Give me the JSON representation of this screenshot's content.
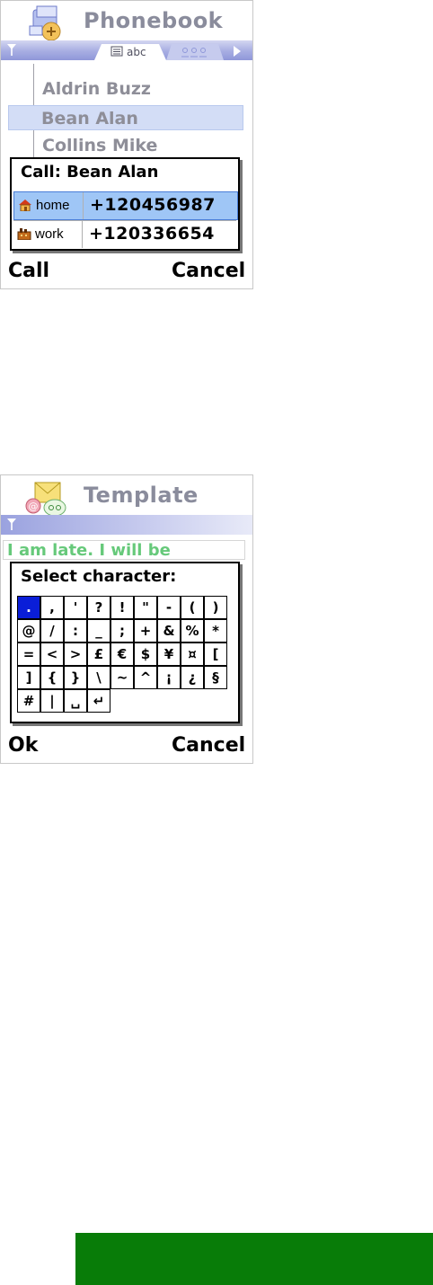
{
  "phonebook_screen": {
    "app_title": "Phonebook",
    "active_tab_label": "abc",
    "contacts": [
      "Aldrin Buzz",
      "Bean Alan",
      "Collins Mike"
    ],
    "selected_contact_index": 1,
    "dialog": {
      "title": "Call: Bean Alan",
      "numbers": [
        {
          "type_icon": "home-icon",
          "type": "home",
          "value": "+120456987",
          "selected": true
        },
        {
          "type_icon": "work-icon",
          "type": "work",
          "value": "+120336654",
          "selected": false
        }
      ]
    },
    "left_softkey": "Call",
    "right_softkey": "Cancel"
  },
  "template_screen": {
    "app_title": "Template",
    "editor_text": "I am late. I will be",
    "dialog": {
      "title": "Select character:",
      "characters": [
        [
          ".",
          ",",
          "'",
          "?",
          "!",
          "\"",
          "-",
          "(",
          ")"
        ],
        [
          "@",
          "/",
          ":",
          "_",
          ";",
          "+",
          "&",
          "%",
          "*"
        ],
        [
          "=",
          "<",
          ">",
          "£",
          "€",
          "$",
          "¥",
          "¤",
          "["
        ],
        [
          "]",
          "{",
          "}",
          "\\",
          "~",
          "^",
          "¡",
          "¿",
          "§"
        ],
        [
          "#",
          "|",
          "␣",
          "↵"
        ]
      ],
      "selected_character": "."
    },
    "left_softkey": "Ok",
    "right_softkey": "Cancel"
  },
  "colors": {
    "nav_bar": "#aab0e3",
    "selected_row": "#d3ddf6",
    "selected_number": "#9fc6f6",
    "selected_char": "#0a1ed8",
    "editor_text": "#66c97a",
    "green_bar": "#087c08"
  }
}
